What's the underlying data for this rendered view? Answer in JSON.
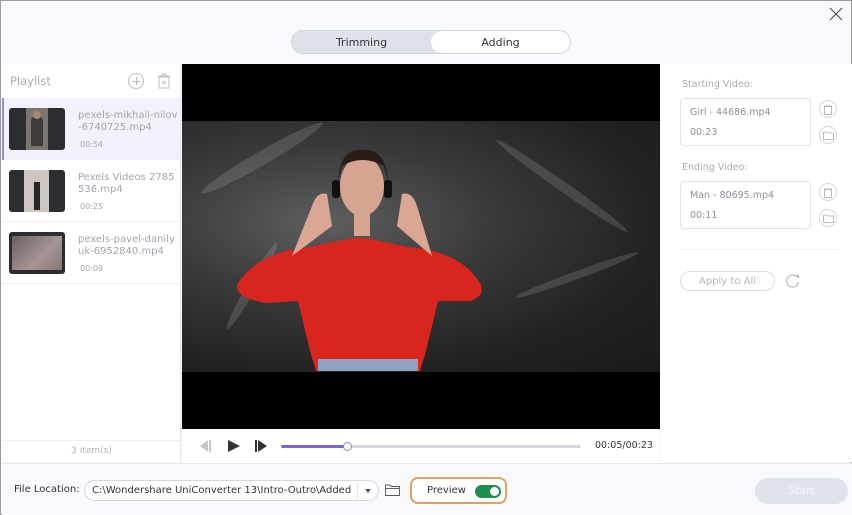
{
  "tabs": [
    {
      "label": "Trimming",
      "active": false
    },
    {
      "label": "Adding",
      "active": true
    }
  ],
  "playlist": {
    "title": "Playlist",
    "items": [
      {
        "name": "pexels-mikhail-nilov-6740725.mp4",
        "duration": "00:54",
        "selected": true
      },
      {
        "name": "Pexels Videos 2785536.mp4",
        "duration": "00:25",
        "selected": false
      },
      {
        "name": "pexels-pavel-danily uk-6952840.mp4",
        "duration": "00:09",
        "selected": false
      }
    ],
    "count": "3 item(s)"
  },
  "player": {
    "time": "00:05/00:23",
    "progress": 0.22
  },
  "right_panel": {
    "starting_label": "Starting Video:",
    "starting_name": "Girl - 44686.mp4",
    "starting_duration": "00:23",
    "ending_label": "Ending Video:",
    "ending_name": "Man - 80695.mp4",
    "ending_duration": "00:11",
    "apply_label": "Apply to All"
  },
  "footer": {
    "file_location_label": "File Location:",
    "file_location_value": "C:\\Wondershare UniConverter 13\\Intro-Outro\\Added",
    "preview_label": "Preview",
    "preview_on": true,
    "start_label": "Start"
  },
  "colors": {
    "accent": "#7d66c8",
    "toggle_on": "#1e8e4e",
    "preview_highlight": "#e0a064"
  }
}
